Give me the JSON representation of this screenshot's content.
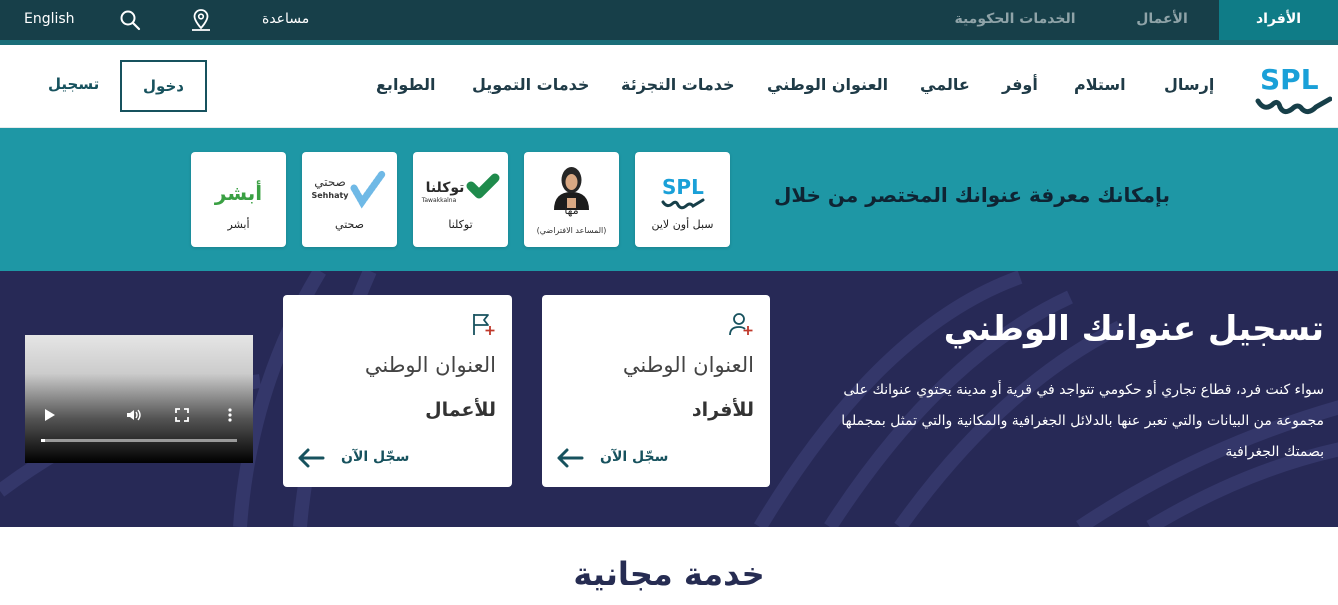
{
  "topbar": {
    "tabs": [
      {
        "label": "الأفراد",
        "active": true
      },
      {
        "label": "الأعمال",
        "active": false
      },
      {
        "label": "الخدمات الحكومية",
        "active": false
      }
    ],
    "help": "مساعدة",
    "language": "English",
    "icons": [
      "location-icon",
      "search-icon"
    ]
  },
  "nav": {
    "logo_text": "SPL",
    "items": [
      "إرسال",
      "استلام",
      "أوفر",
      "عالمي",
      "العنوان الوطني",
      "خدمات التجزئة",
      "خدمات التمويل",
      "الطوابع"
    ],
    "login": "دخول",
    "register": "تسجيل"
  },
  "band": {
    "title": "بإمكانك معرفة عنوانك المختصر من خلال",
    "services": [
      {
        "label": "سبل أون لاين",
        "logo": "spl-logo"
      },
      {
        "label": "مها",
        "sub": "(المساعد الافتراضي)",
        "logo": "maha-avatar"
      },
      {
        "label": "توكلنا",
        "logo_text": "توكلنا",
        "logo_sub": "Tawakkalna"
      },
      {
        "label": "صحتي",
        "logo_text": "صحتي",
        "logo_sub": "Sehhaty"
      },
      {
        "label": "أبشر",
        "logo_text": "أبشر"
      }
    ]
  },
  "hero": {
    "title": "تسجيل عنوانك الوطني",
    "description": "سواء كنت فرد، قطاع تجاري أو حكومي تتواجد في قرية أو مدينة يحتوي عنوانك على مجموعة من البيانات والتي تعبر عنها بالدلائل الجغرافية والمكانية والتي تمثل بمجملها بصمتك الجغرافية",
    "cards": [
      {
        "title": "العنوان الوطني",
        "subtitle": "للأفراد",
        "cta": "سجّل الآن",
        "icon": "add-user-icon"
      },
      {
        "title": "العنوان الوطني",
        "subtitle": "للأعمال",
        "cta": "سجّل الآن",
        "icon": "flag-plus-icon"
      }
    ],
    "video": {
      "progress": 0.02
    }
  },
  "section": {
    "title": "خدمة مجانية"
  },
  "colors": {
    "topbar": "#173f49",
    "active_tab": "#0f7c87",
    "band": "#1e97a5",
    "hero": "#272956",
    "accent": "#17525e"
  }
}
